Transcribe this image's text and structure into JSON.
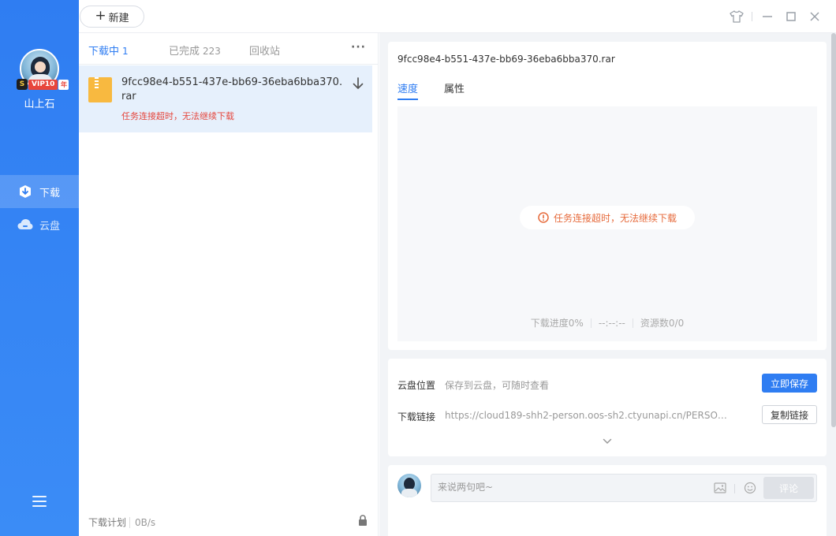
{
  "user": {
    "name": "山上石",
    "vip_label": "VIP10",
    "vip_suffix": "年",
    "vip_s": "S"
  },
  "nav": {
    "download": "下载",
    "cloud": "云盘"
  },
  "toolbar": {
    "new_label": "新建",
    "new_plus": "+"
  },
  "tabs": {
    "downloading": {
      "label": "下载中",
      "count": "1"
    },
    "completed": {
      "label": "已完成",
      "count": "223"
    },
    "recycle": {
      "label": "回收站"
    },
    "more": "···"
  },
  "task": {
    "name": "9fcc98e4-b551-437e-bb69-36eba6bba370.rar",
    "error": "任务连接超时，无法继续下载"
  },
  "footer": {
    "plan_label": "下载计划",
    "speed": "0B/s"
  },
  "detail": {
    "name": "9fcc98e4-b551-437e-bb69-36eba6bba370.rar",
    "tab_speed": "速度",
    "tab_attr": "属性",
    "error": "任务连接超时，无法继续下载",
    "progress": "下载进度0%",
    "time": "--:--:--",
    "sources": "资源数0/0"
  },
  "cloud": {
    "location_label": "云盘位置",
    "location_value": "保存到云盘，可随时查看",
    "save_btn": "立即保存",
    "link_label": "下载链接",
    "link_value": "https://cloud189-shh2-person.oos-sh2.ctyunapi.cn/PERSONC...",
    "copy_btn": "复制链接"
  },
  "comment": {
    "placeholder": "来说两句吧~",
    "send": "评论"
  },
  "colors": {
    "accent": "#2f7df2",
    "error": "#e5453c",
    "folder": "#f8b940"
  }
}
